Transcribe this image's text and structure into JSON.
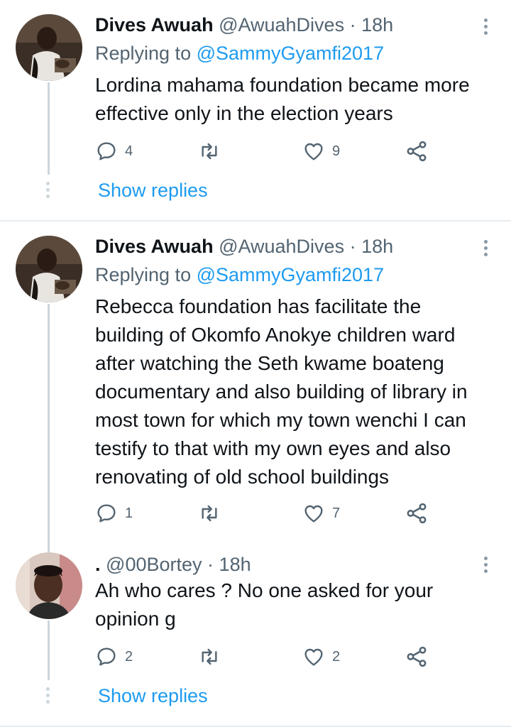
{
  "tweets": [
    {
      "name": "Dives Awuah",
      "handle": "@AwuahDives",
      "sep": "·",
      "time": "18h",
      "reply_prefix": "Replying to ",
      "reply_to": "@SammyGyamfi2017",
      "text": "Lordina mahama foundation became more  effective only in the election years",
      "replies": "4",
      "retweets": "",
      "likes": "9",
      "show_replies": "Show replies",
      "avatar_icon": "person-photo-icon"
    },
    {
      "name": "Dives Awuah",
      "handle": "@AwuahDives",
      "sep": "·",
      "time": "18h",
      "reply_prefix": "Replying to ",
      "reply_to": "@SammyGyamfi2017",
      "text": "Rebecca foundation has facilitate the building of Okomfo Anokye children ward after watching the Seth kwame boateng documentary and also building of library in most town for which my town wenchi I can testify to that with my own eyes and also renovating of old school buildings",
      "replies": "1",
      "retweets": "",
      "likes": "7",
      "avatar_icon": "person-photo-icon"
    },
    {
      "name": ".",
      "handle": "@00Bortey",
      "sep": "·",
      "time": "18h",
      "text": "Ah who cares ? No one asked for your opinion g",
      "replies": "2",
      "retweets": "",
      "likes": "2",
      "show_replies": "Show replies",
      "avatar_icon": "person-photo-icon"
    }
  ],
  "colors": {
    "accent": "#1d9bf0",
    "secondary_text": "#536471",
    "primary_text": "#0f1419",
    "divider": "#e6ecf0"
  }
}
